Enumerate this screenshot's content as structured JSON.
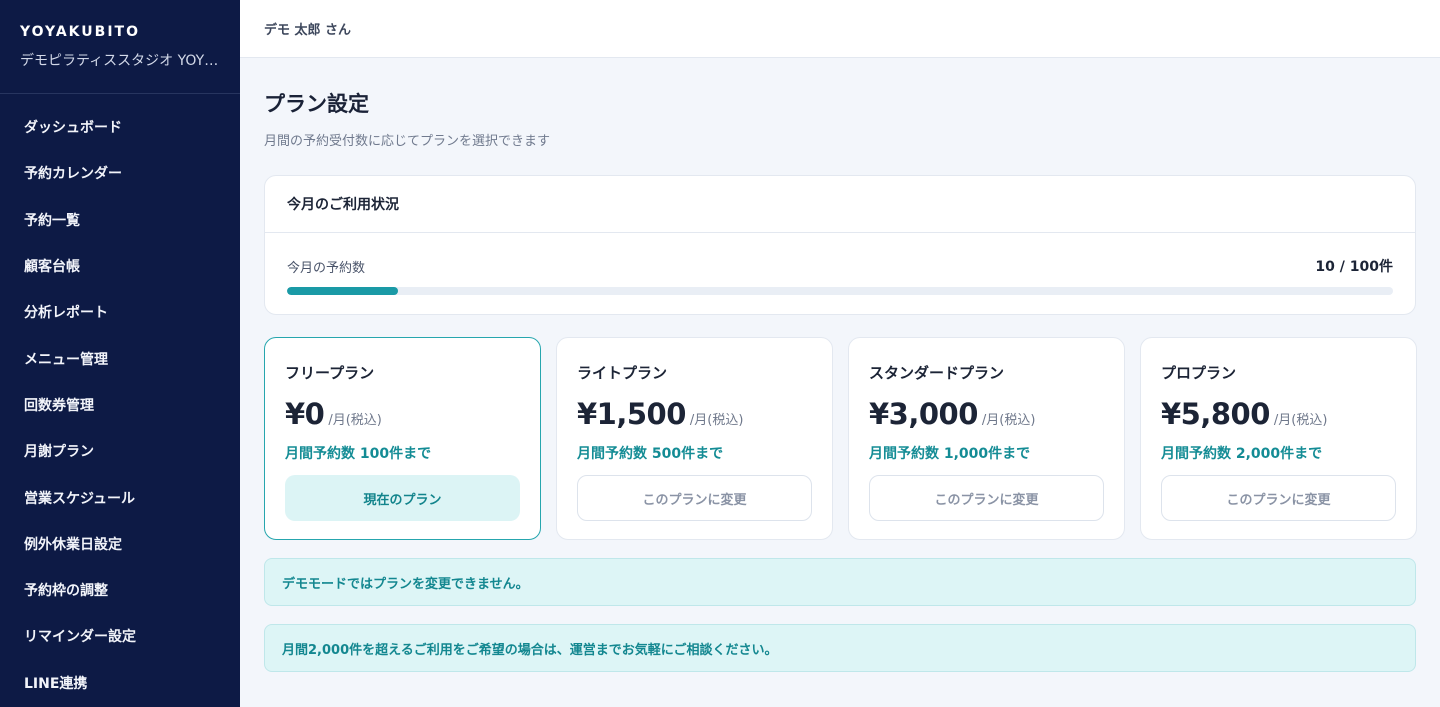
{
  "brand": {
    "name": "YOYAKUBITO",
    "studio": "デモピラティススタジオ YOY…"
  },
  "sidebar": {
    "items": [
      {
        "label": "ダッシュボード"
      },
      {
        "label": "予約カレンダー"
      },
      {
        "label": "予約一覧"
      },
      {
        "label": "顧客台帳"
      },
      {
        "label": "分析レポート"
      },
      {
        "label": "メニュー管理"
      },
      {
        "label": "回数券管理"
      },
      {
        "label": "月謝プラン"
      },
      {
        "label": "営業スケジュール"
      },
      {
        "label": "例外休業日設定"
      },
      {
        "label": "予約枠の調整"
      },
      {
        "label": "リマインダー設定"
      },
      {
        "label": "LINE連携"
      }
    ]
  },
  "header": {
    "user": "デモ 太郎 さん"
  },
  "page": {
    "title": "プラン設定",
    "subtitle": "月間の予約受付数に応じてプランを選択できます"
  },
  "usage": {
    "title": "今月のご利用状況",
    "label": "今月の予約数",
    "count": "10 / 100件",
    "used": 10,
    "limit": 100
  },
  "plans": [
    {
      "name": "フリープラン",
      "price": "¥0",
      "unit": "/月(税込)",
      "limit": "月間予約数 100件まで",
      "button": "現在のプラン",
      "current": true
    },
    {
      "name": "ライトプラン",
      "price": "¥1,500",
      "unit": "/月(税込)",
      "limit": "月間予約数 500件まで",
      "button": "このプランに変更",
      "current": false
    },
    {
      "name": "スタンダードプラン",
      "price": "¥3,000",
      "unit": "/月(税込)",
      "limit": "月間予約数 1,000件まで",
      "button": "このプランに変更",
      "current": false
    },
    {
      "name": "プロプラン",
      "price": "¥5,800",
      "unit": "/月(税込)",
      "limit": "月間予約数 2,000件まで",
      "button": "このプランに変更",
      "current": false
    }
  ],
  "notices": {
    "demo": "デモモードではプランを変更できません。",
    "contact": "月間2,000件を超えるご利用をご希望の場合は、運営までお気軽にご相談ください。"
  },
  "colors": {
    "sidebar_bg": "#0d1a45",
    "accent": "#1a9aa6",
    "notice_bg": "#ddf5f6"
  }
}
